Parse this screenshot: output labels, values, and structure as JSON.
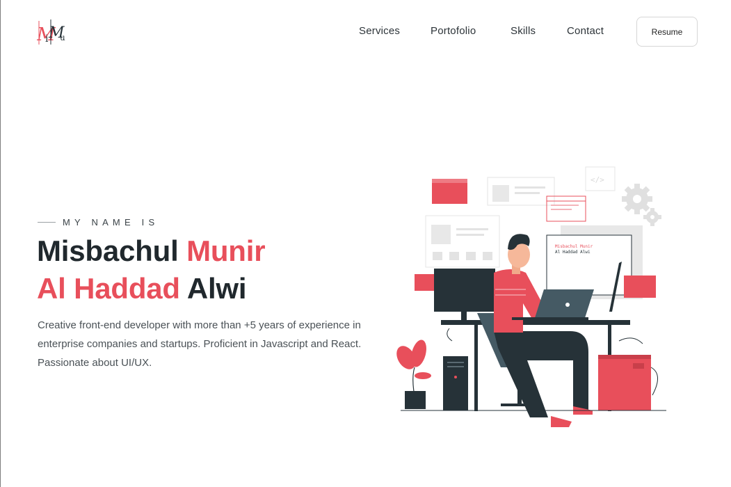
{
  "header": {
    "logo_text": "MiMu",
    "nav": [
      {
        "label": "Services"
      },
      {
        "label": "Portofolio"
      },
      {
        "label": "Skills"
      },
      {
        "label": "Contact"
      }
    ],
    "resume_label": "Resume"
  },
  "hero": {
    "eyebrow": "MY NAME IS",
    "name_first": "Misbachul",
    "name_second": "Munir",
    "name_third": "Al Haddad",
    "name_fourth": "Alwi",
    "description": "Creative front-end developer with more than +5 years of experience in enterprise companies and startups. Proficient in Javascript and React. Passionate about UI/UX."
  },
  "illustration": {
    "screen_line_1": "Misbachul Munir",
    "screen_line_2": "Al Haddad Alwi"
  },
  "colors": {
    "accent": "#e84f5b",
    "dark": "#263238",
    "text": "#20282d"
  }
}
